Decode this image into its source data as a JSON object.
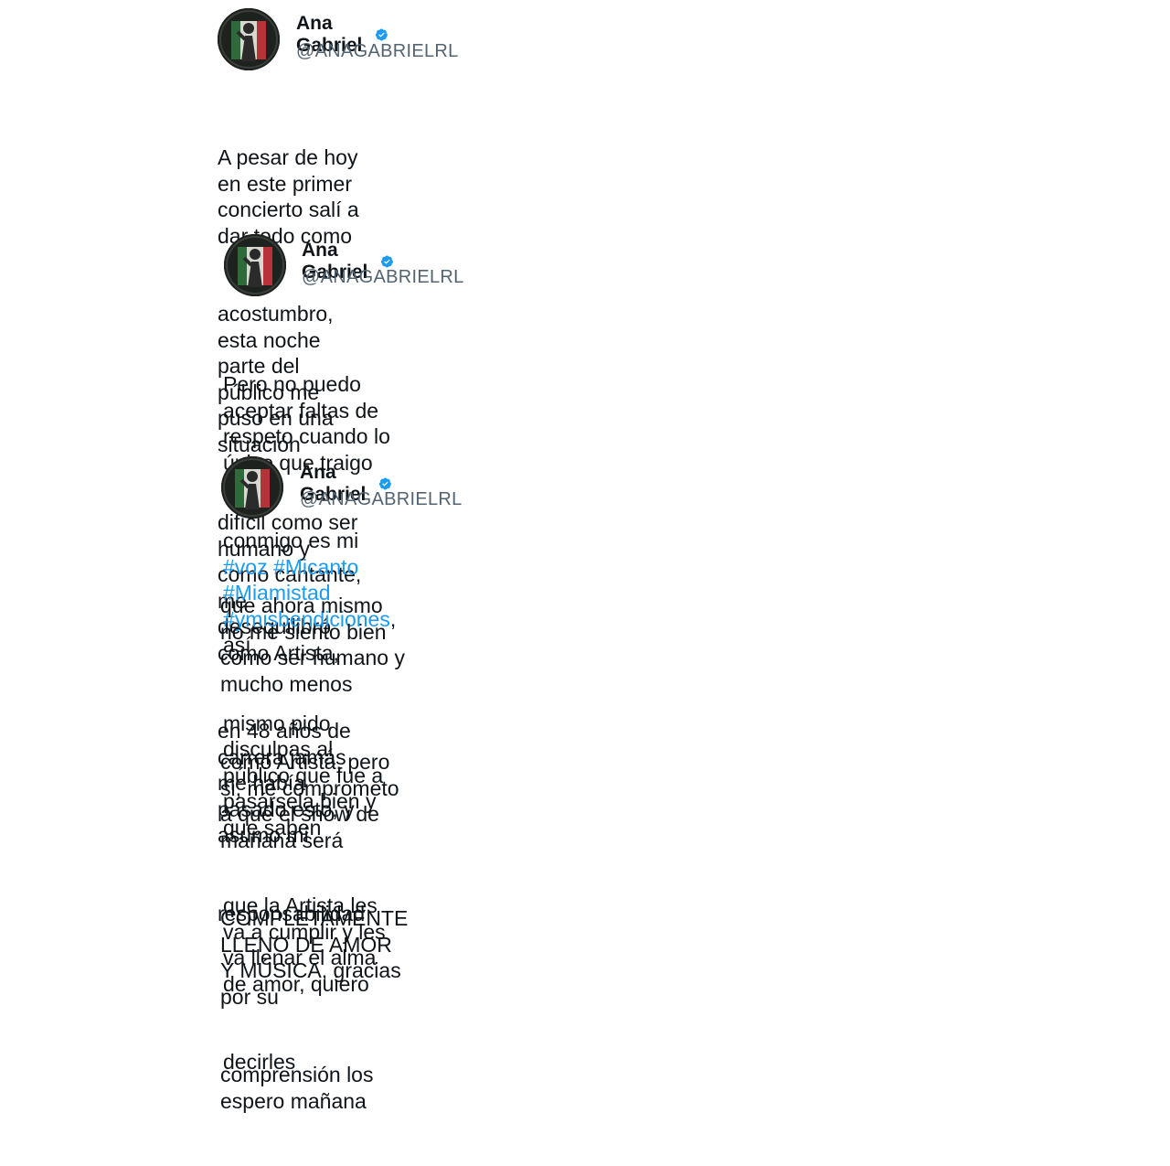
{
  "tweets": [
    {
      "author": {
        "name": "Ana Gabriel",
        "handle": "@ANAGABRIELRL",
        "verified": true,
        "avatar_icon": "profile-photo"
      },
      "lines": [
        "A pesar de hoy en este primer concierto salí a dar todo como",
        "acostumbro, esta noche parte del público me puso en una situación",
        "difícil como ser humano y como cantante, me desequilibró como Artista,",
        "en 48 años de carrera jamás me había pasado esto, y asumo mi",
        "responsabilidad"
      ]
    },
    {
      "author": {
        "name": "Ana Gabriel",
        "handle": "@ANAGABRIELRL",
        "verified": true,
        "avatar_icon": "profile-photo"
      },
      "lines": [
        "Pero no puedo aceptar faltas de respeto cuando lo único que traigo",
        "mismo pido disculpas al público que fue a pasársela bien y que saben",
        "que la Artista les va a cumplir y les va llenar el alma de amor, quiero",
        "decirles"
      ],
      "line2": {
        "prefix": "conmigo es mi ",
        "hashtags": [
          "#voz",
          "#Micanto",
          "#Miamistad",
          "#ymisbendiciones"
        ],
        "suffix": ", así"
      }
    },
    {
      "author": {
        "name": "Ana Gabriel",
        "handle": "@ANAGABRIELRL",
        "verified": true,
        "avatar_icon": "profile-photo"
      },
      "lines": [
        "que ahora mismo no me siento bien como ser humano y mucho menos",
        "como Artista, pero si, me comprometo a que el show de mañana será",
        "COMPLETAMENTE LLENO DE AMOR Y MÚSICA, gracias por su",
        "comprensión los espero mañana"
      ]
    }
  ],
  "colors": {
    "text": "#0f1419",
    "handle": "#536471",
    "hashtag": "#1d9bf0",
    "verified": "#1d9bf0"
  }
}
